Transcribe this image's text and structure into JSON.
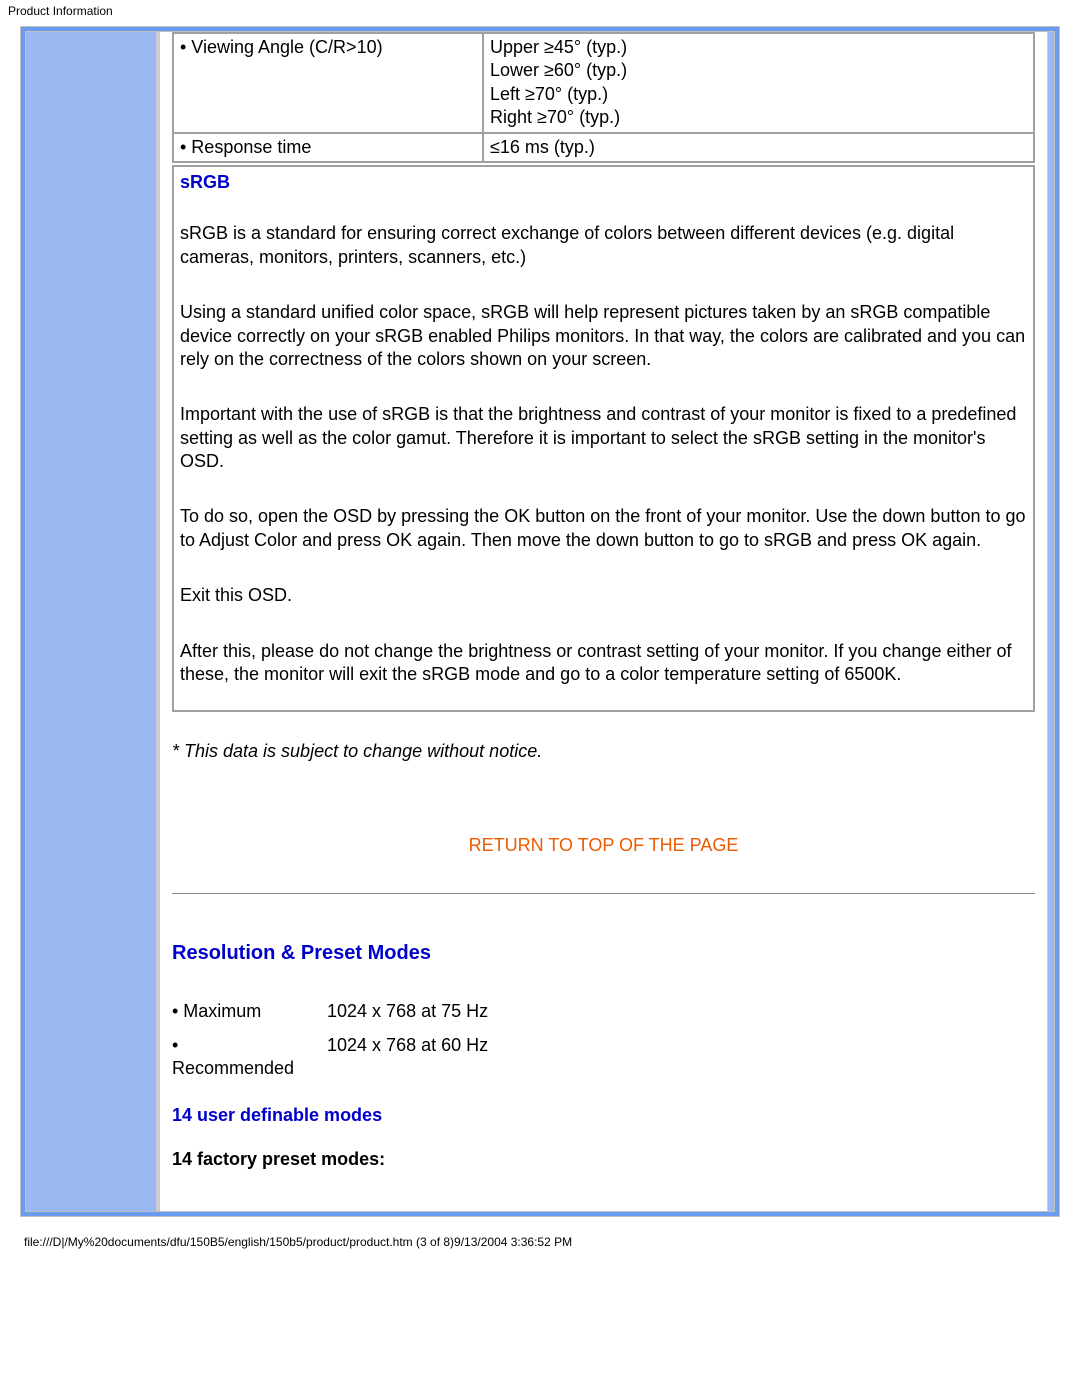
{
  "header": {
    "title": "Product Information"
  },
  "spec_table": {
    "row1": {
      "label": "• Viewing Angle (C/R>10)",
      "value_l1": "Upper ≥45° (typ.)",
      "value_l2": "Lower ≥60° (typ.)",
      "value_l3": "Left ≥70° (typ.)",
      "value_l4": "Right ≥70° (typ.)"
    },
    "row2": {
      "label": "• Response time",
      "value": "≤16 ms (typ.)"
    }
  },
  "srgb": {
    "title": "sRGB",
    "p1": "sRGB is a standard for ensuring correct exchange of colors between different devices (e.g. digital cameras, monitors, printers, scanners, etc.)",
    "p2": "Using a standard unified color space, sRGB will help represent pictures taken by an sRGB compatible device correctly on your sRGB enabled Philips monitors. In that way, the colors are calibrated and you can rely on the correctness of the colors shown on your screen.",
    "p3": "Important with the use of sRGB is that the brightness and contrast of your monitor is fixed to a predefined setting as well as the color gamut. Therefore it is important to select the sRGB setting in the monitor's OSD.",
    "p4": "To do so, open the OSD by pressing the OK button on the front of your monitor. Use the down button to go to Adjust Color and press OK again. Then move the down button to go to sRGB and press OK again.",
    "p5": "Exit this OSD.",
    "p6": "After this, please do not change the brightness or contrast setting of your monitor. If you change either of these, the monitor will exit the sRGB mode and go to a color temperature setting of 6500K."
  },
  "notice": "* This data is subject to change without notice.",
  "return_link": "RETURN TO TOP OF THE PAGE",
  "resolution": {
    "title": "Resolution & Preset Modes",
    "max_label": "• Maximum",
    "max_value": "1024 x 768 at 75 Hz",
    "rec_bullet": "•",
    "rec_label": "Recommended",
    "rec_value": "1024 x 768 at 60 Hz",
    "user_def": "14 user definable modes",
    "factory": "14 factory preset modes:"
  },
  "footer": {
    "path": "file:///D|/My%20documents/dfu/150B5/english/150b5/product/product.htm (3 of 8)9/13/2004 3:36:52 PM"
  }
}
